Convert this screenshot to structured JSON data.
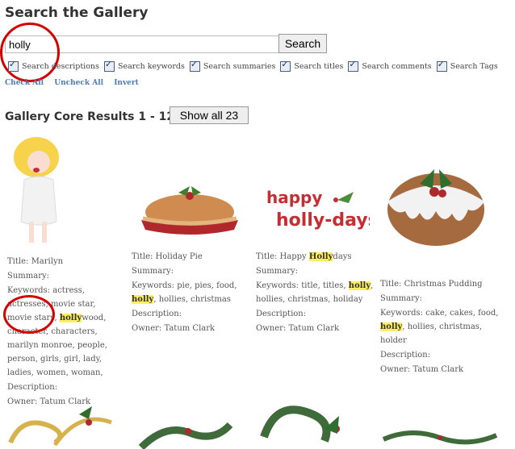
{
  "page": {
    "title": "Search the Gallery",
    "search_value": "holly",
    "search_button": "Search",
    "check_options": [
      {
        "label": "Search descriptions",
        "checked": true
      },
      {
        "label": "Search keywords",
        "checked": true
      },
      {
        "label": "Search summaries",
        "checked": true
      },
      {
        "label": "Search titles",
        "checked": true
      },
      {
        "label": "Search comments",
        "checked": true
      },
      {
        "label": "Search Tags",
        "checked": true
      }
    ],
    "links": {
      "check_all": "Check All",
      "uncheck_all": "Uncheck All",
      "invert": "Invert"
    },
    "results_title": "Gallery Core Results 1 - 12",
    "show_all": "Show all 23"
  },
  "results": [
    {
      "title_label": "Title:",
      "title": "Marilyn",
      "summary_label": "Summary:",
      "keywords_label": "Keywords:",
      "keywords_pre": "actress, actresses, movie star, movie stars,",
      "keywords_hl": "holly",
      "keywords_post": "wood, character, characters, marilyn monroe, people, person, girls, girl, lady, ladies, women, woman,",
      "description_label": "Description:",
      "owner_label": "Owner:",
      "owner": "Tatum Clark"
    },
    {
      "title_label": "Title:",
      "title": "Holiday Pie",
      "summary_label": "Summary:",
      "keywords_label": "Keywords:",
      "keywords_pre": "pie, pies, food,",
      "keywords_hl": "holly",
      "keywords_post": ", hollies, christmas",
      "description_label": "Description:",
      "owner_label": "Owner:",
      "owner": "Tatum Clark"
    },
    {
      "title_label": "Title:",
      "title_pre": "Happy ",
      "title_hl": "Holly",
      "title_post": "days",
      "summary_label": "Summary:",
      "keywords_label": "Keywords:",
      "keywords_pre": "title, titles,",
      "keywords_hl": "holly",
      "keywords_post": ", hollies, christmas, holiday",
      "description_label": "Description:",
      "owner_label": "Owner:",
      "owner": "Tatum Clark",
      "image_text_1": "happy",
      "image_text_2": "holly-days"
    },
    {
      "title_label": "Title:",
      "title": "Christmas Pudding",
      "summary_label": "Summary:",
      "keywords_label": "Keywords:",
      "keywords_pre": "cake, cakes, food,",
      "keywords_hl": "holly",
      "keywords_post": ", hollies, christmas, holder",
      "description_label": "Description:",
      "owner_label": "Owner:",
      "owner": "Tatum Clark"
    }
  ]
}
